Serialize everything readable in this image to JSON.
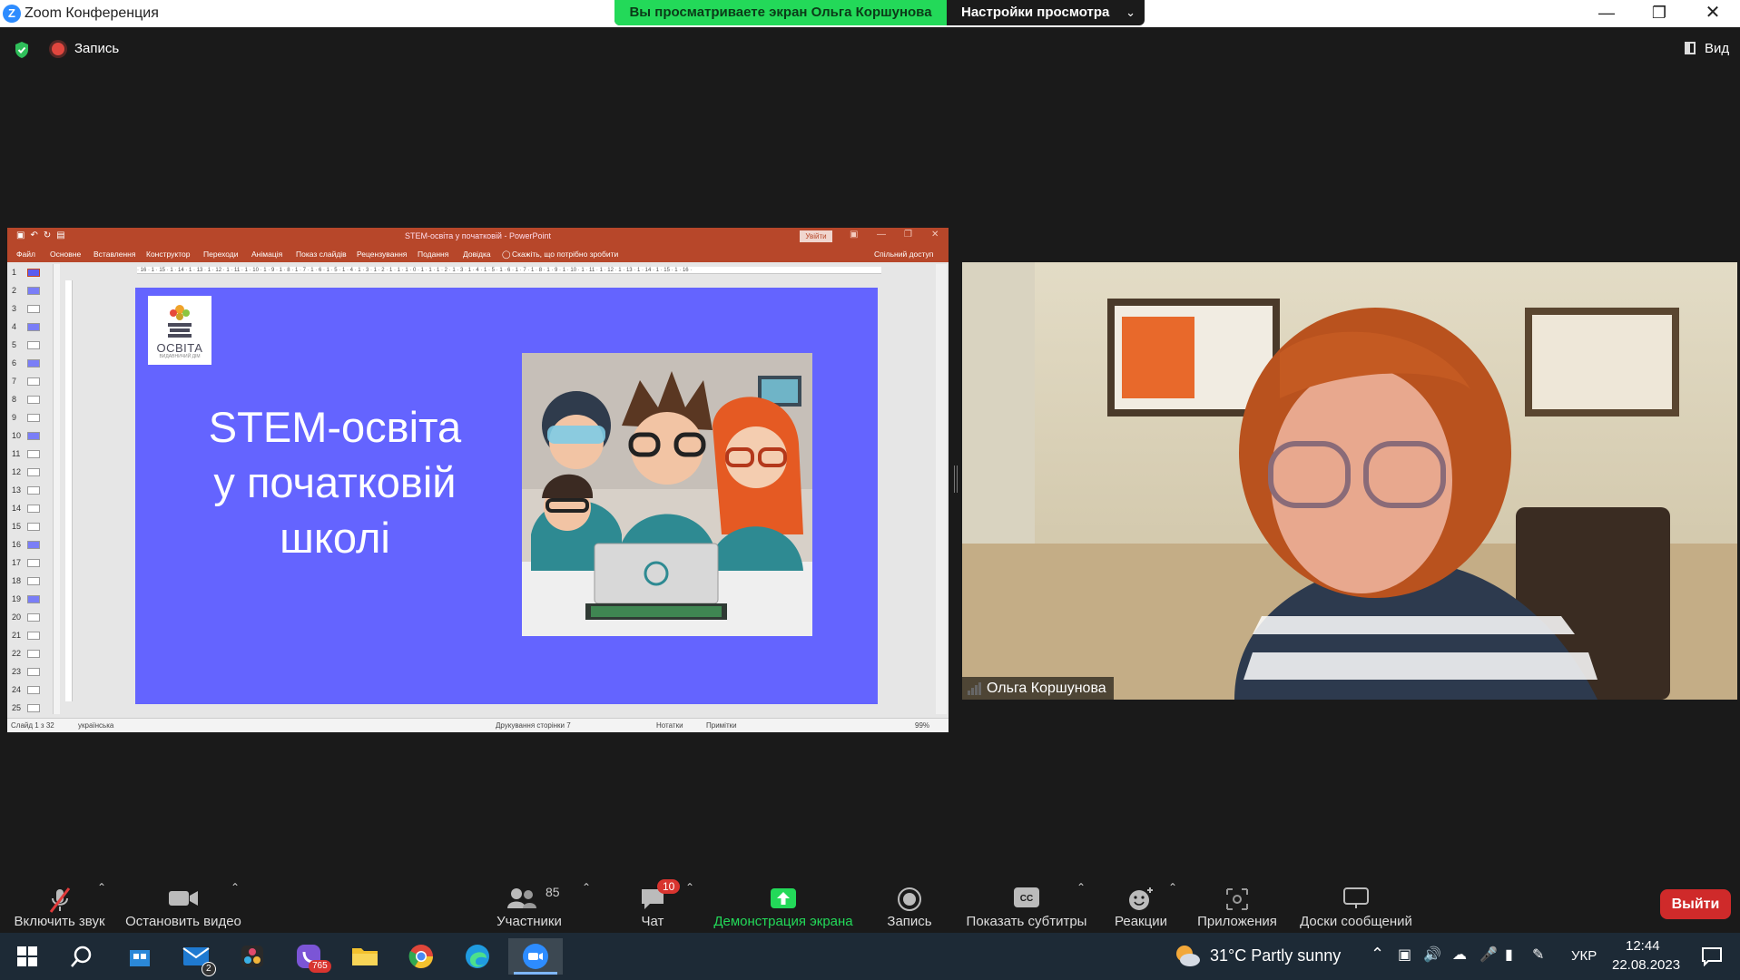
{
  "window": {
    "title": "Zoom Конференция",
    "controls": [
      "minimize",
      "restore",
      "close"
    ]
  },
  "share_banner": {
    "viewing_text": "Вы просматриваете экран Ольга Коршунова",
    "settings_label": "Настройки просмотра"
  },
  "meeting_top": {
    "recording_label": "Запись",
    "view_label": "Вид"
  },
  "powerpoint": {
    "doc_title": "STEM-освіта у початковій - PowerPoint",
    "signin_label": "Увійти",
    "tabs": [
      "Файл",
      "Основне",
      "Вставлення",
      "Конструктор",
      "Переходи",
      "Анімація",
      "Показ слайдів",
      "Рецензування",
      "Подання",
      "Довідка"
    ],
    "tell_me": "Скажіть, що потрібно зробити",
    "share_label": "Спільний доступ",
    "ruler_text": "· 16 · 1 · 15 · 1 · 14 · 1 · 13 · 1 · 12 · 1 · 11 · 1 · 10 · 1 · 9 · 1 · 8 · 1 · 7 · 1 · 6 · 1 · 5 · 1 · 4 · 1 · 3 · 1 · 2 · 1 · 1 · 1 · 0 · 1 · 1 · 1 · 2 · 1 · 3 · 1 · 4 · 1 · 5 · 1 · 6 · 1 · 7 · 1 · 8 · 1 · 9 · 1 · 10 · 1 · 11 · 1 · 12 · 1 · 13 · 1 · 14 · 1 · 15 · 1 · 16 ·",
    "thumbnails": [
      "1",
      "2",
      "3",
      "4",
      "5",
      "6",
      "7",
      "8",
      "9",
      "10",
      "11",
      "12",
      "13",
      "14",
      "15",
      "16",
      "17",
      "18",
      "19",
      "20",
      "21",
      "22",
      "23",
      "24",
      "25"
    ],
    "status": {
      "slide_info": "Слайд 1 з 32",
      "language": "українська",
      "print_pages": "Друкування сторінки 7",
      "notes": "Нотатки",
      "comments": "Примітки",
      "zoom": "99%"
    },
    "slide": {
      "logo_text": "ОСВІТА",
      "logo_sub": "ВИДАВНИЧИЙ ДІМ",
      "heading_line1": "STEM-освіта",
      "heading_line2": "у початковій",
      "heading_line3": "школі",
      "background_color": "#6464ff"
    }
  },
  "video": {
    "participant_name": "Ольга Коршунова"
  },
  "toolbar": {
    "unmute_label": "Включить звук",
    "stop_video_label": "Остановить видео",
    "participants_label": "Участники",
    "participants_count": "85",
    "chat_label": "Чат",
    "chat_badge": "10",
    "share_screen_label": "Демонстрация экрана",
    "record_label": "Запись",
    "captions_label": "Показать субтитры",
    "reactions_label": "Реакции",
    "apps_label": "Приложения",
    "whiteboards_label": "Доски сообщений",
    "leave_label": "Выйти",
    "share_color": "#23d959"
  },
  "taskbar": {
    "apps": [
      "windows-start",
      "search",
      "store",
      "mail",
      "davinci",
      "viber",
      "file-explorer",
      "chrome",
      "edge",
      "zoom"
    ],
    "mail_badge": "2",
    "viber_badge": "765",
    "weather": "31°C  Partly sunny",
    "language": "УКР",
    "time": "12:44",
    "date": "22.08.2023"
  }
}
